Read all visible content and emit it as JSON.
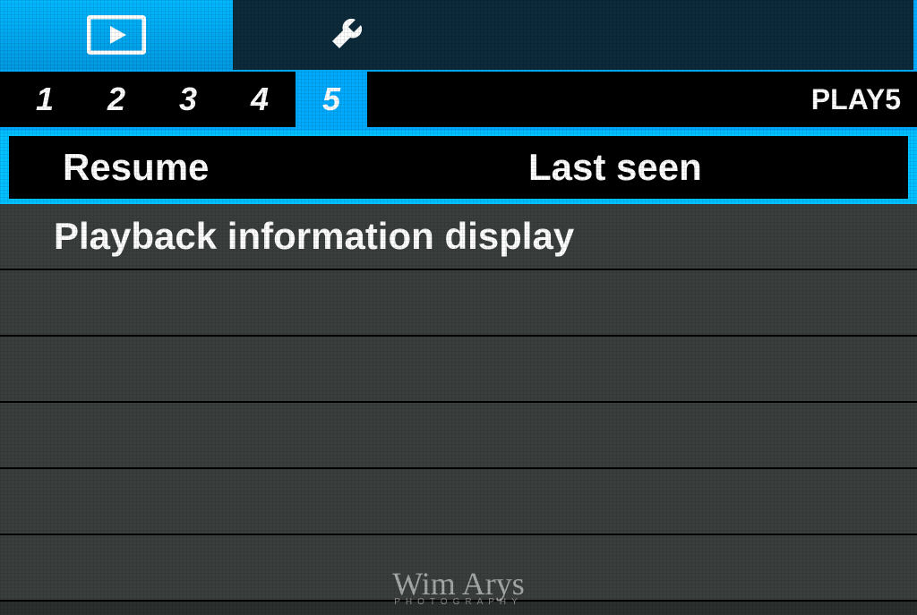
{
  "top_tabs": {
    "playback_icon": "playback",
    "settings_icon": "wrench"
  },
  "pages": {
    "items": [
      "1",
      "2",
      "3",
      "4",
      "5"
    ],
    "active_index": 4,
    "label": "PLAY5"
  },
  "menu": {
    "rows": [
      {
        "label": "Resume",
        "value": "Last seen",
        "selected": true
      },
      {
        "label": "Playback information display",
        "value": "",
        "selected": false
      },
      {
        "label": "",
        "value": "",
        "selected": false
      },
      {
        "label": "",
        "value": "",
        "selected": false
      },
      {
        "label": "",
        "value": "",
        "selected": false
      },
      {
        "label": "",
        "value": "",
        "selected": false
      },
      {
        "label": "",
        "value": "",
        "selected": false
      }
    ]
  },
  "watermark": {
    "name": "Wim Arys",
    "sub": "PHOTOGRAPHY"
  }
}
